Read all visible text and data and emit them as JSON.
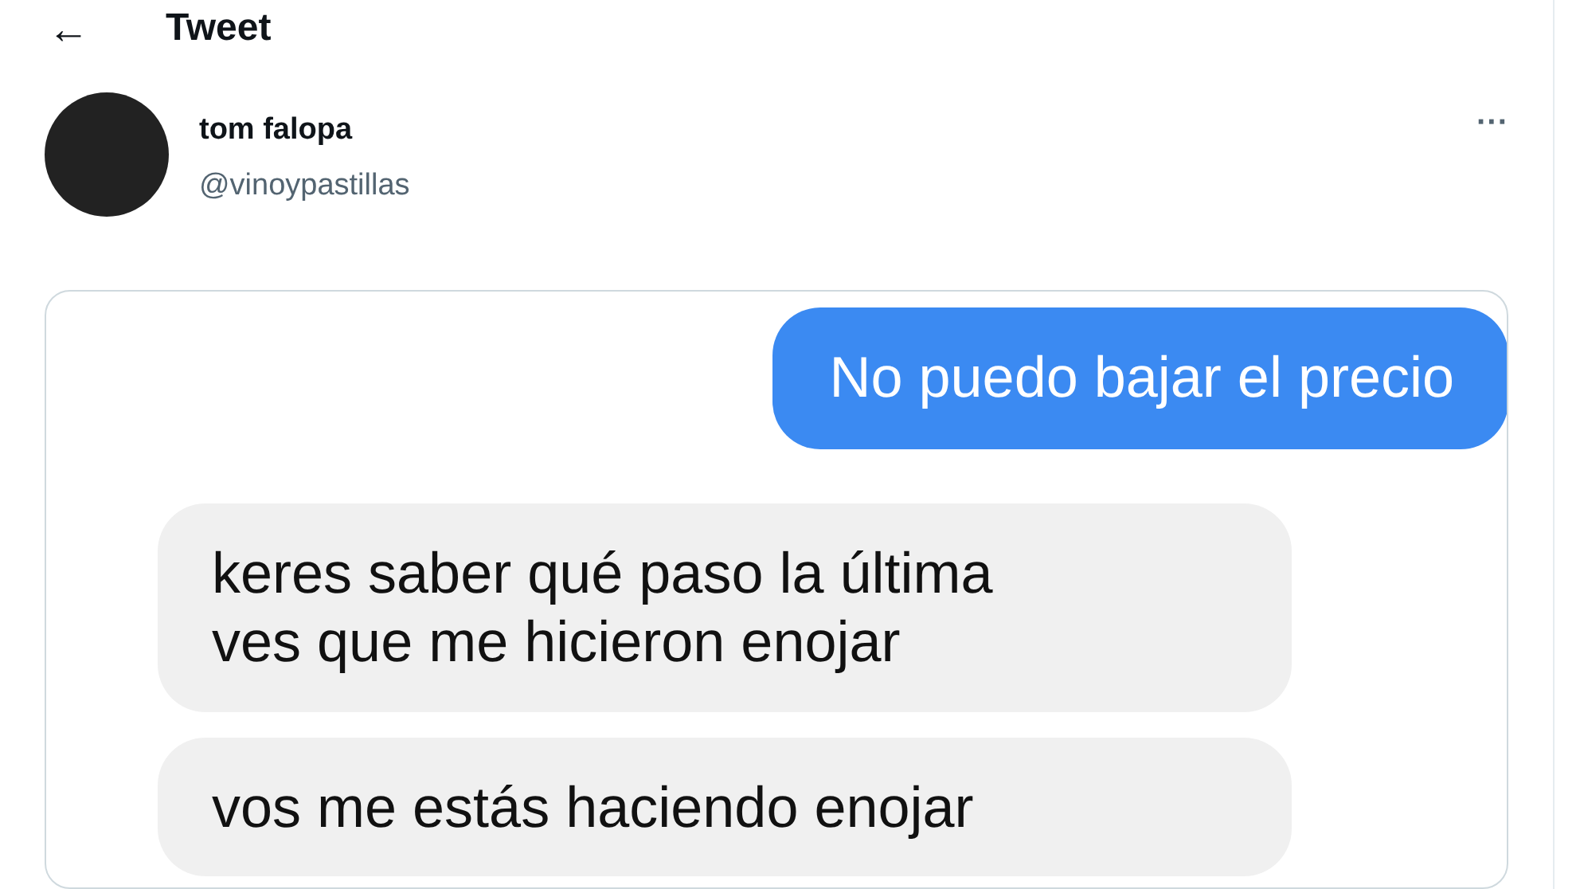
{
  "header": {
    "back_icon": "←",
    "title": "Tweet"
  },
  "author": {
    "name": "tom falopa",
    "handle": "@vinoypastillas",
    "more": "···"
  },
  "image": {
    "messages": [
      {
        "kind": "sent",
        "text": "No puedo bajar el precio"
      },
      {
        "kind": "received",
        "lines": [
          "keres saber qué paso la última",
          "ves que me hicieron enojar"
        ]
      },
      {
        "kind": "received",
        "lines": [
          "vos me estás haciendo enojar"
        ]
      }
    ]
  }
}
